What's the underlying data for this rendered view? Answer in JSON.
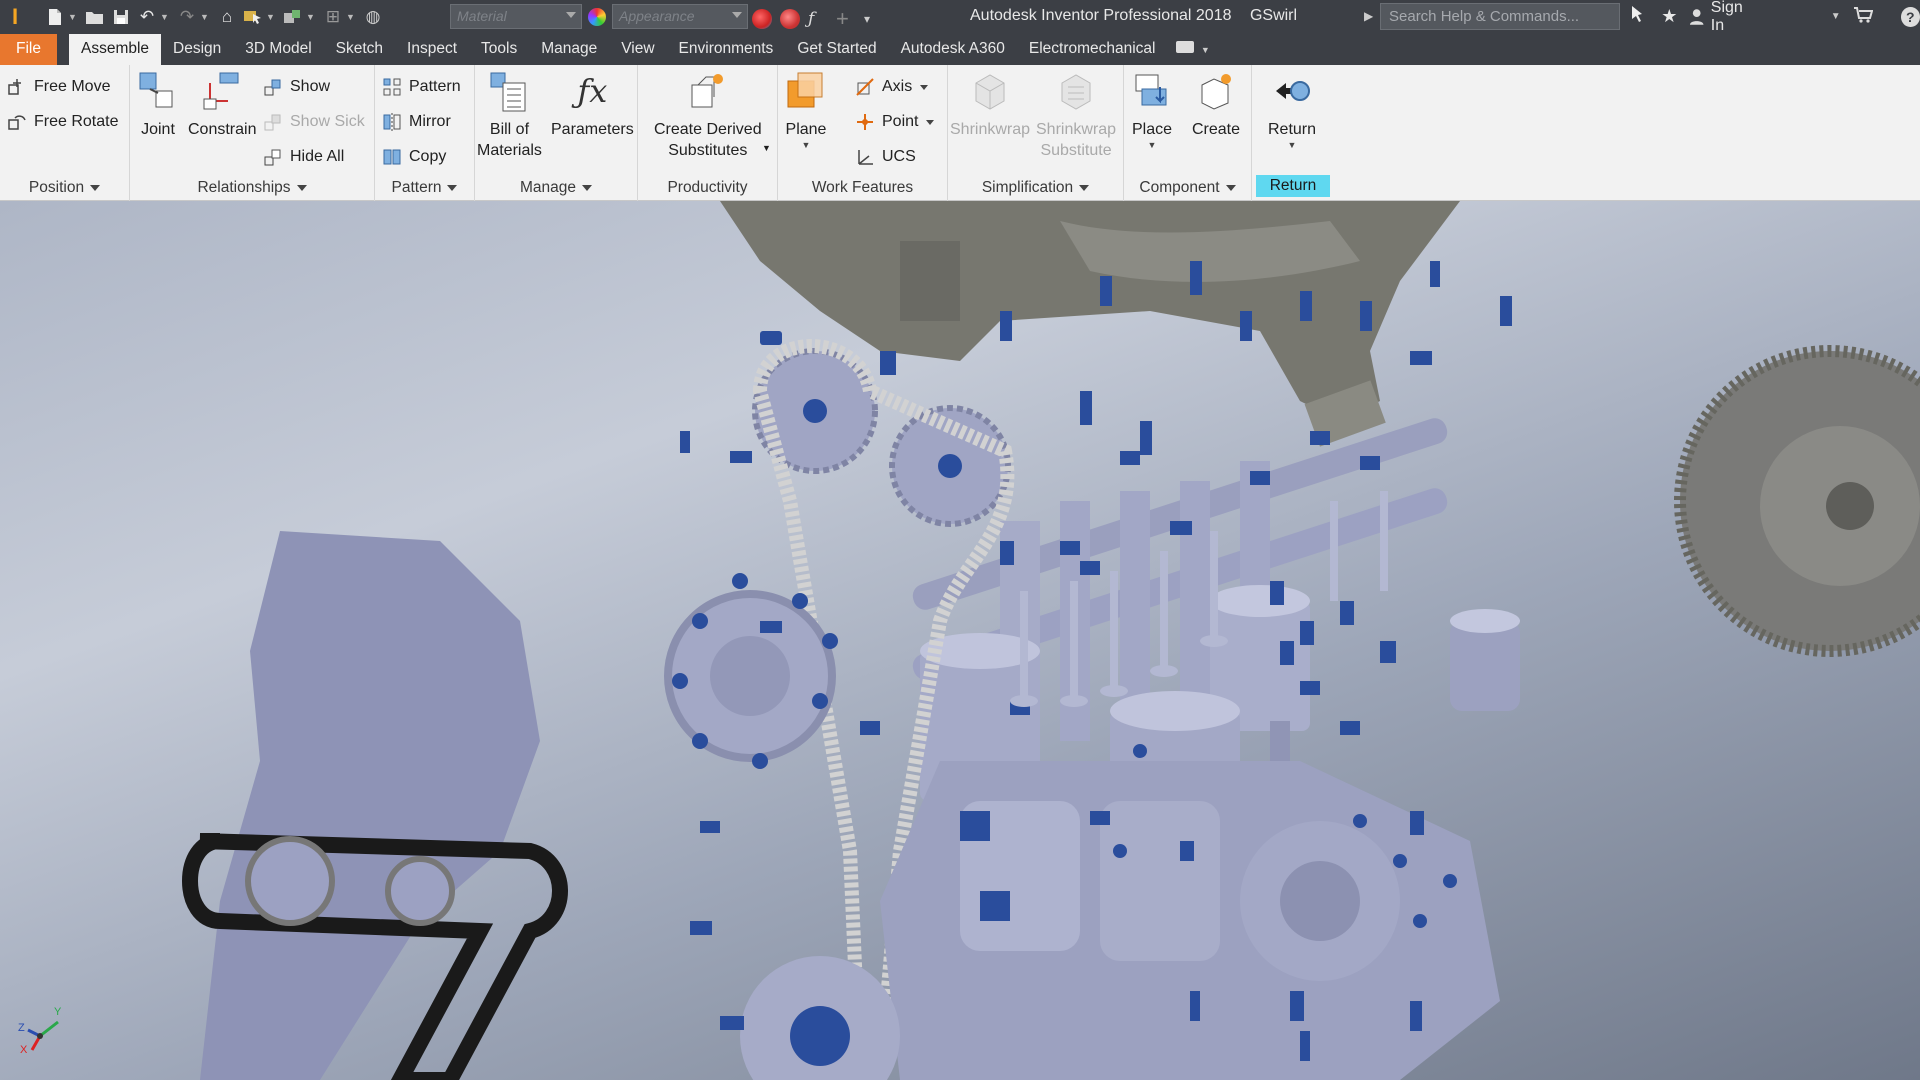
{
  "title_bar": {
    "app_title": "Autodesk Inventor Professional 2018",
    "file_name": "GSwirl",
    "material_placeholder": "Material",
    "appearance_placeholder": "Appearance",
    "search_placeholder": "Search Help & Commands...",
    "sign_in": "Sign In",
    "icons": [
      "pro-logo-icon",
      "new-file-icon",
      "open-icon",
      "save-icon",
      "undo-icon",
      "redo-icon",
      "home-icon",
      "select-icon",
      "measure-icon",
      "update-icon",
      "appearance-ball-icon",
      "color-override-icon",
      "clear-override-icon",
      "function-icon",
      "plus-icon",
      "customize-icon",
      "sign-icon",
      "star-icon",
      "user-icon",
      "cart-icon",
      "help-icon"
    ]
  },
  "tabs": [
    {
      "label": "File"
    },
    {
      "label": "Assemble",
      "active": true
    },
    {
      "label": "Design"
    },
    {
      "label": "3D Model"
    },
    {
      "label": "Sketch"
    },
    {
      "label": "Inspect"
    },
    {
      "label": "Tools"
    },
    {
      "label": "Manage"
    },
    {
      "label": "View"
    },
    {
      "label": "Environments"
    },
    {
      "label": "Get Started"
    },
    {
      "label": "Autodesk A360"
    },
    {
      "label": "Electromechanical"
    }
  ],
  "ribbon": {
    "position": {
      "label": "Position",
      "free_move": "Free Move",
      "free_rotate": "Free Rotate"
    },
    "relationships": {
      "label": "Relationships",
      "joint": "Joint",
      "constrain": "Constrain",
      "show": "Show",
      "show_sick": "Show Sick",
      "hide_all": "Hide All"
    },
    "pattern": {
      "label": "Pattern",
      "pattern": "Pattern",
      "mirror": "Mirror",
      "copy": "Copy"
    },
    "manage": {
      "label": "Manage",
      "bom_line1": "Bill of",
      "bom_line2": "Materials",
      "parameters": "Parameters"
    },
    "productivity": {
      "label": "Productivity",
      "cds_line1": "Create Derived",
      "cds_line2": "Substitutes"
    },
    "work_features": {
      "label": "Work Features",
      "plane": "Plane",
      "axis": "Axis",
      "point": "Point",
      "ucs": "UCS"
    },
    "simplification": {
      "label": "Simplification",
      "shrinkwrap": "Shrinkwrap",
      "sws_line1": "Shrinkwrap",
      "sws_line2": "Substitute"
    },
    "component": {
      "label": "Component",
      "place": "Place",
      "create": "Create"
    },
    "return": {
      "label": "Return",
      "return": "Return"
    }
  },
  "viewport": {
    "axis_labels": {
      "x": "X",
      "y": "Y",
      "z": "Z"
    },
    "colors": {
      "part": "#9aa0c8",
      "bolt": "#2a4d9c",
      "chain": "#d0d0d0",
      "belt": "#1a1a1a",
      "flywheel": "#7a7a78"
    }
  }
}
